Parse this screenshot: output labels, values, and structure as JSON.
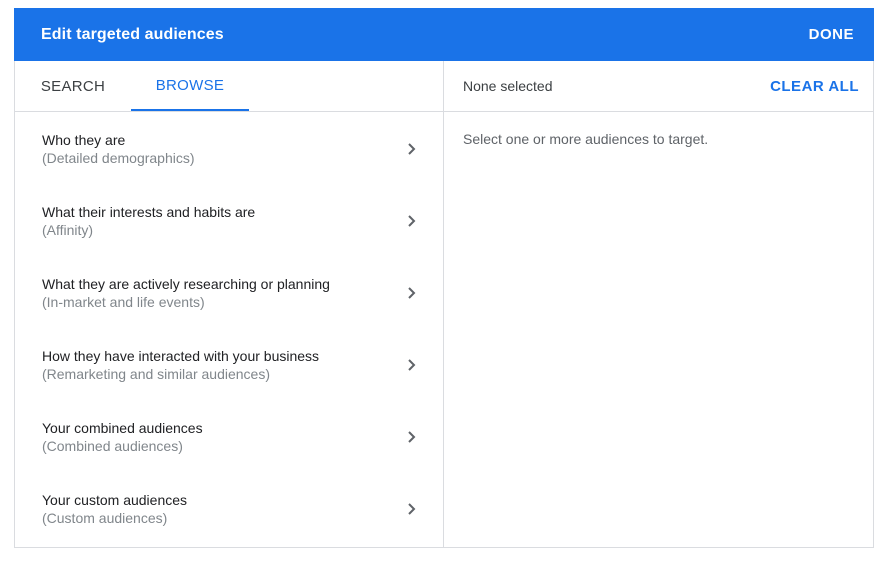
{
  "header": {
    "title": "Edit targeted audiences",
    "done_label": "DONE"
  },
  "tabs": [
    {
      "label": "SEARCH",
      "active": false
    },
    {
      "label": "BROWSE",
      "active": true
    }
  ],
  "browse_items": [
    {
      "title": "Who they are",
      "subtitle": "(Detailed demographics)"
    },
    {
      "title": "What their interests and habits are",
      "subtitle": "(Affinity)"
    },
    {
      "title": "What they are actively researching or planning",
      "subtitle": "(In-market and life events)"
    },
    {
      "title": "How they have interacted with your business",
      "subtitle": "(Remarketing and similar audiences)"
    },
    {
      "title": "Your combined audiences",
      "subtitle": "(Combined audiences)"
    },
    {
      "title": "Your custom audiences",
      "subtitle": "(Custom audiences)"
    }
  ],
  "selection": {
    "status": "None selected",
    "clear_all_label": "CLEAR ALL",
    "empty_message": "Select one or more audiences to target."
  },
  "colors": {
    "header_bg": "#1a73e8",
    "accent": "#1a73e8",
    "divider": "#dadce0"
  },
  "icons": {
    "list_item_arrow": "chevron-right-icon"
  }
}
